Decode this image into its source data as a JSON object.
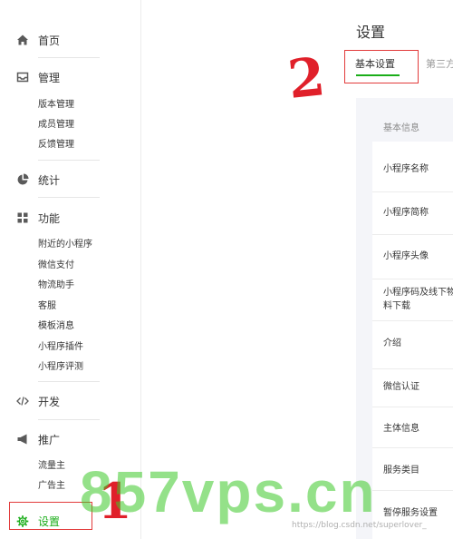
{
  "sidebar": {
    "home": "首页",
    "manage": {
      "label": "管理",
      "items": [
        "版本管理",
        "成员管理",
        "反馈管理"
      ]
    },
    "stats": "统计",
    "features": {
      "label": "功能",
      "items": [
        "附近的小程序",
        "微信支付",
        "物流助手",
        "客服",
        "模板消息",
        "小程序插件",
        "小程序评测"
      ]
    },
    "develop": "开发",
    "promote": {
      "label": "推广",
      "items": [
        "流量主",
        "广告主"
      ]
    },
    "settings": "设置"
  },
  "main": {
    "title": "设置",
    "tabs": [
      {
        "label": "基本设置",
        "active": true
      },
      {
        "label": "第三方",
        "active": false
      }
    ],
    "section_header": "基本信息",
    "rows": [
      "小程序名称",
      "小程序简称",
      "小程序头像",
      "小程序码及线下物料下载",
      "介绍",
      "微信认证",
      "主体信息",
      "服务类目",
      "暂停服务设置"
    ]
  },
  "annotations": {
    "one": "1",
    "two": "2"
  },
  "watermark": {
    "text": "857vps.cn",
    "url": "https://blog.csdn.net/superlover_"
  },
  "colors": {
    "accent": "#1aad19",
    "annotation": "#e23b3b"
  }
}
